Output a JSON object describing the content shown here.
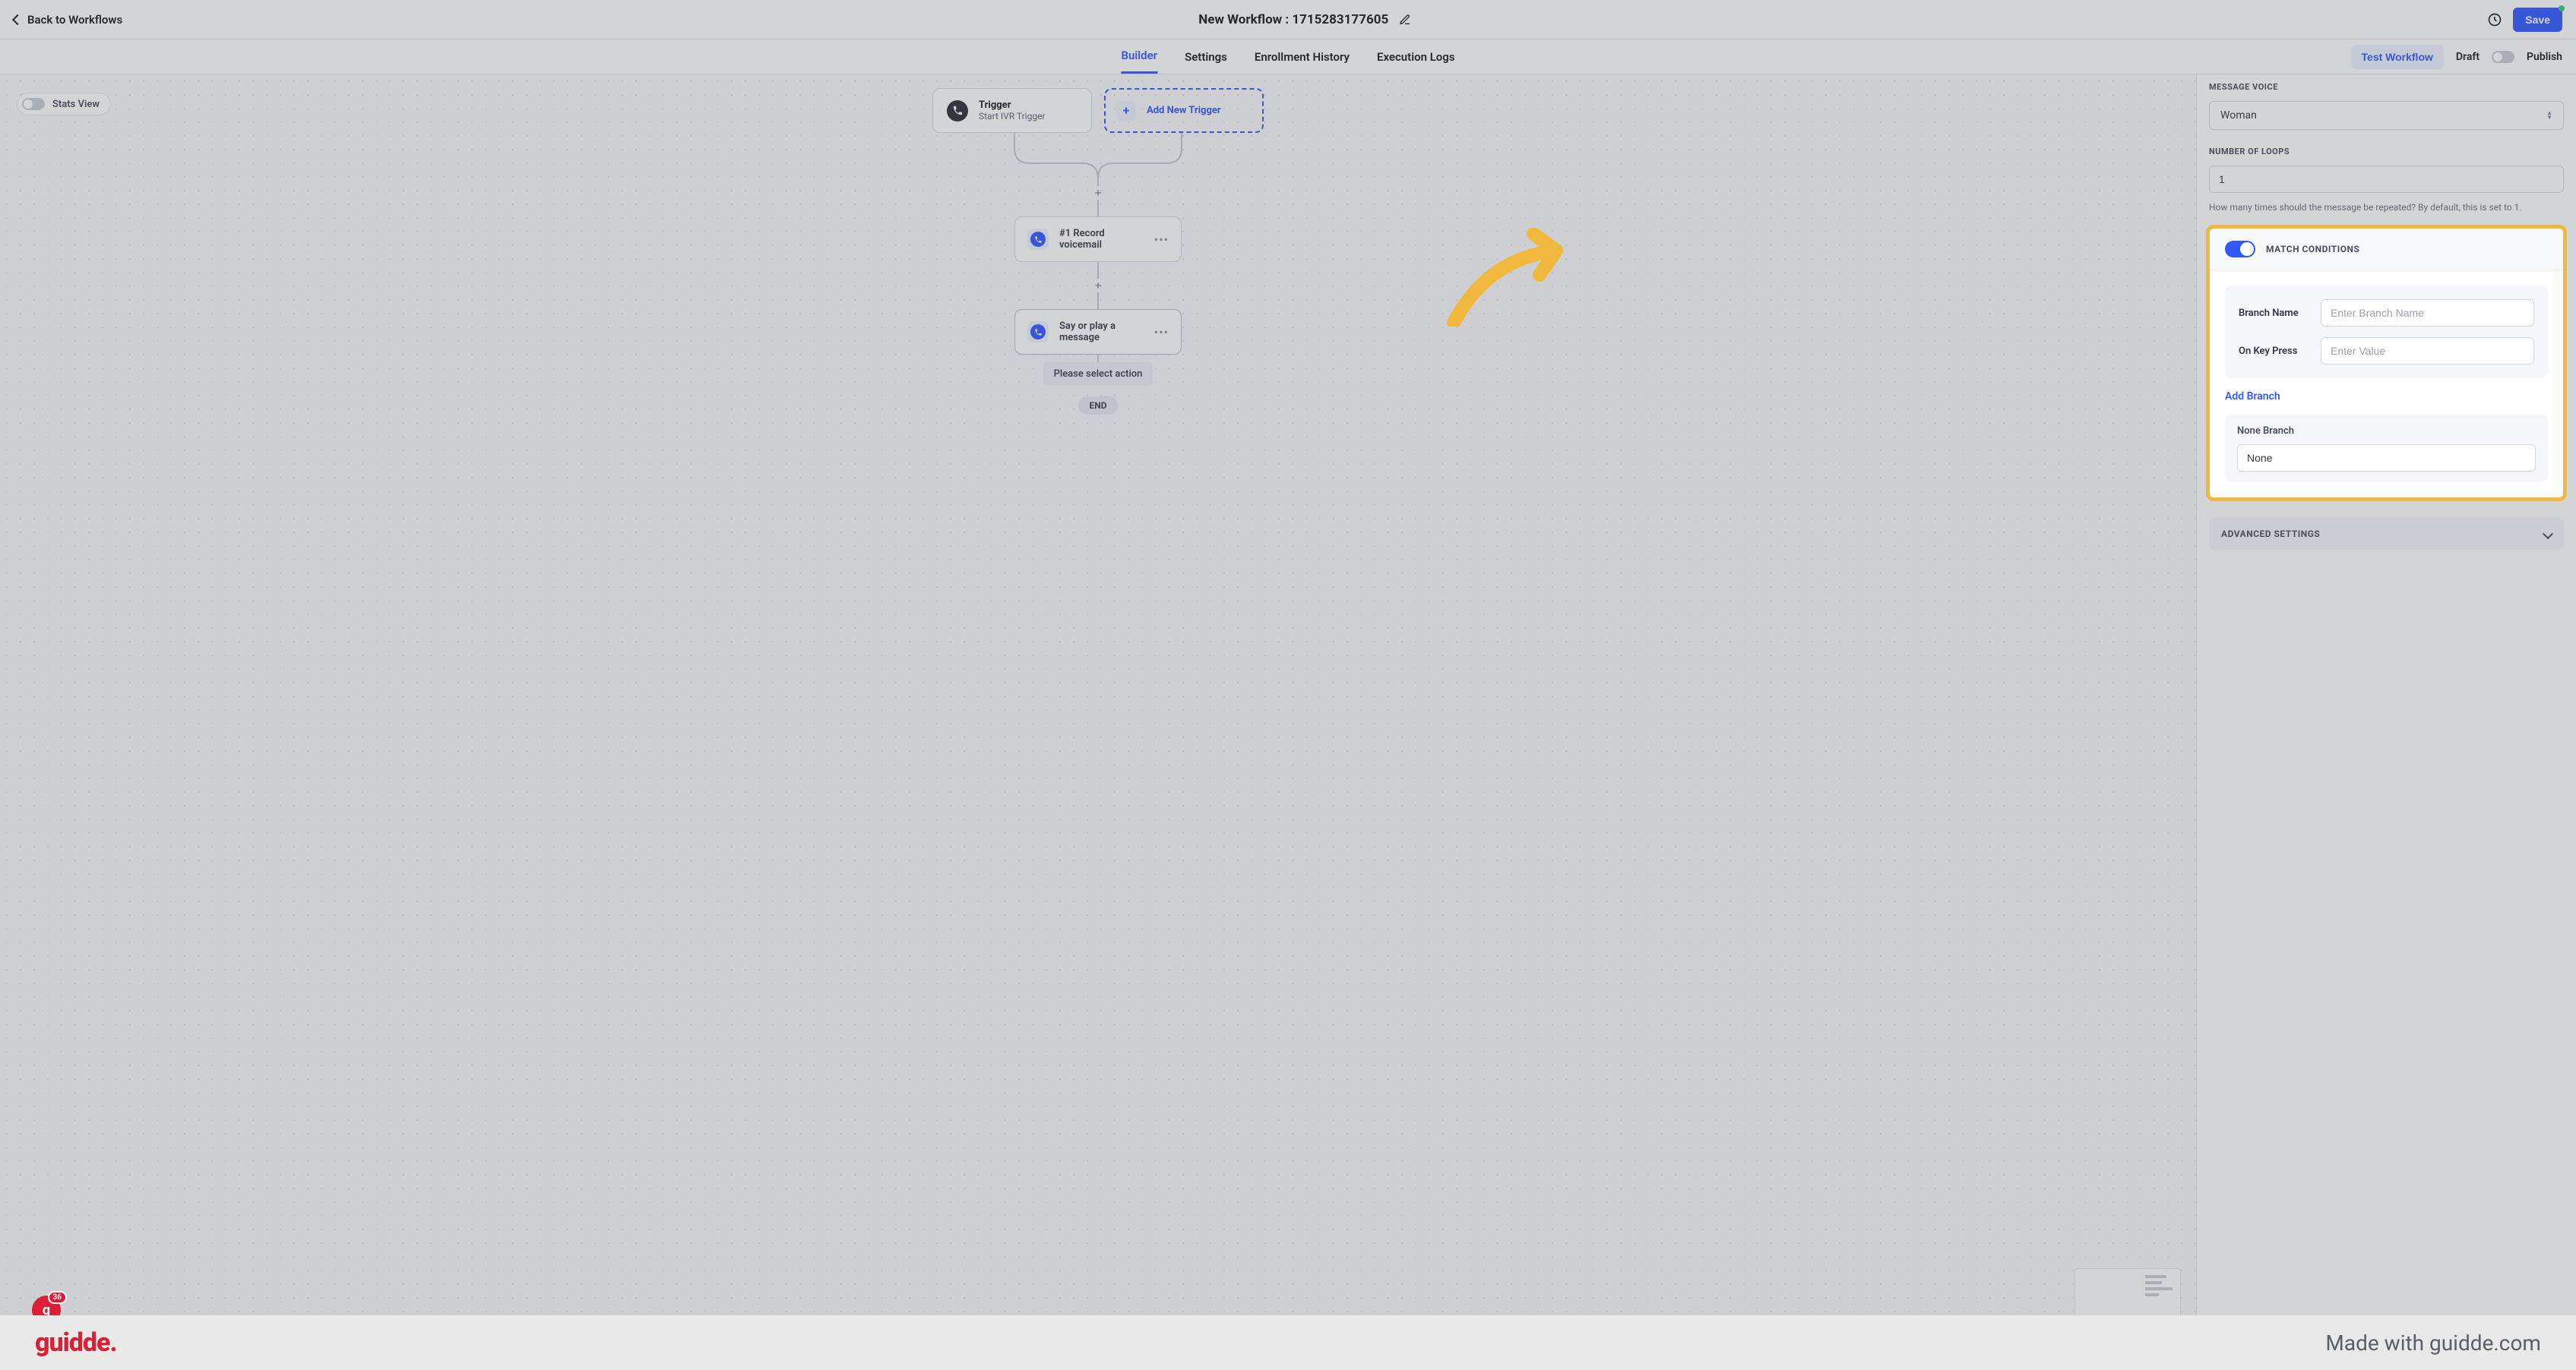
{
  "header": {
    "back_label": "Back to Workflows",
    "title": "New Workflow : 1715283177605",
    "save_label": "Save"
  },
  "tabs": {
    "items": [
      "Builder",
      "Settings",
      "Enrollment History",
      "Execution Logs"
    ],
    "test_label": "Test Workflow",
    "draft_label": "Draft",
    "publish_label": "Publish"
  },
  "canvas": {
    "stats_view_label": "Stats View",
    "trigger_title": "Trigger",
    "trigger_sub": "Start IVR Trigger",
    "add_trigger_label": "Add New Trigger",
    "step1_label": "#1 Record voicemail",
    "step2_label": "Say or play a message",
    "select_action_label": "Please select action",
    "end_label": "END"
  },
  "panel": {
    "message_voice_label": "MESSAGE VOICE",
    "message_voice_value": "Woman",
    "loops_label": "NUMBER OF LOOPS",
    "loops_value": "1",
    "loops_help": "How many times should the message be repeated? By default, this is set to 1.",
    "match_cond_label": "MATCH CONDITIONS",
    "branch_name_label": "Branch Name",
    "branch_name_placeholder": "Enter Branch Name",
    "key_press_label": "On Key Press",
    "key_press_placeholder": "Enter Value",
    "add_branch_label": "Add Branch",
    "none_branch_label": "None Branch",
    "none_branch_value": "None",
    "advanced_label": "ADVANCED SETTINGS"
  },
  "badge": {
    "count": "36"
  },
  "footer": {
    "logo": "guidde.",
    "made_with": "Made with guidde.com"
  }
}
